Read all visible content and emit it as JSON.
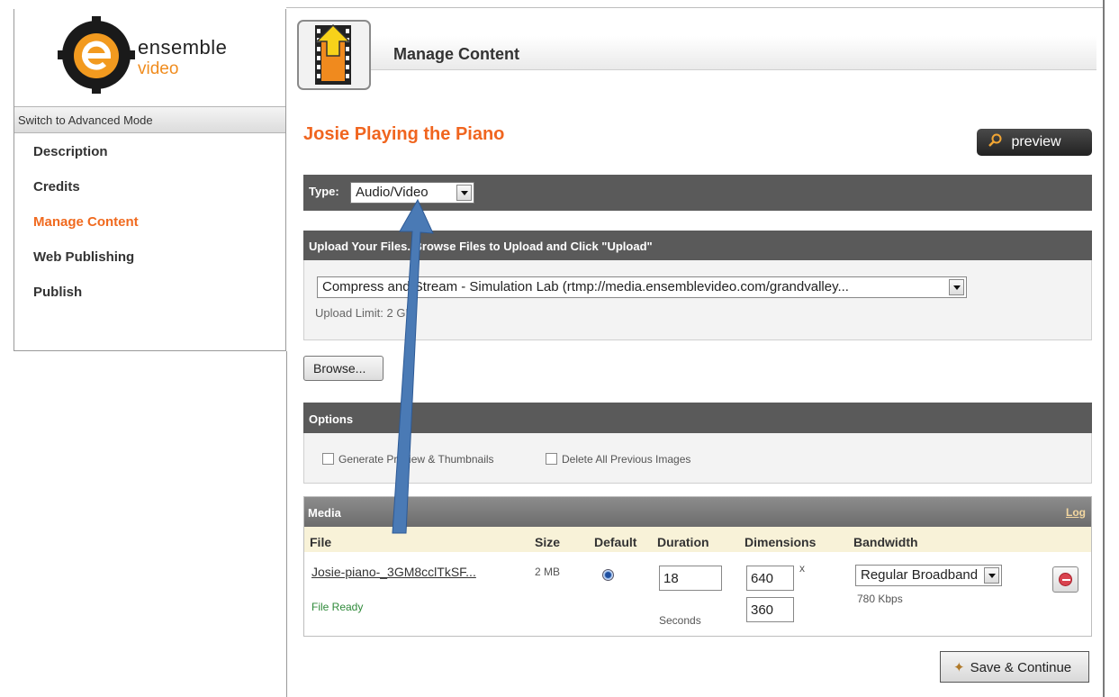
{
  "brand": {
    "name": "ensemble",
    "sub": "video"
  },
  "sidebar": {
    "advanced_mode": "Switch to Advanced Mode",
    "items": [
      {
        "label": "Description"
      },
      {
        "label": "Credits"
      },
      {
        "label": "Manage Content",
        "active": true
      },
      {
        "label": "Web Publishing"
      },
      {
        "label": "Publish"
      }
    ]
  },
  "header": {
    "title": "Manage Content"
  },
  "content": {
    "title": "Josie Playing the Piano",
    "preview_label": "preview"
  },
  "type": {
    "label": "Type:",
    "value": "Audio/Video"
  },
  "upload": {
    "header": "Upload Your Files. Browse Files to Upload and Click \"Upload\"",
    "profile": "Compress and Stream - Simulation Lab (rtmp://media.ensemblevideo.com/grandvalley...",
    "limit": "Upload Limit: 2 GB",
    "browse_label": "Browse..."
  },
  "options": {
    "header": "Options",
    "generate_preview": "Generate Preview & Thumbnails",
    "delete_images": "Delete All Previous Images"
  },
  "media": {
    "header": "Media",
    "log_label": "Log",
    "columns": {
      "file": "File",
      "size": "Size",
      "default": "Default",
      "duration": "Duration",
      "dimensions": "Dimensions",
      "bandwidth": "Bandwidth"
    },
    "row": {
      "file": "Josie-piano-_3GM8cclTkSF...",
      "status": "File Ready",
      "size": "2 MB",
      "duration": "18",
      "duration_unit": "Seconds",
      "width": "640",
      "height": "360",
      "dim_sep": "x",
      "bandwidth": "Regular Broadband",
      "bitrate": "780 Kbps"
    }
  },
  "save_label": "Save & Continue",
  "colors": {
    "accent_orange": "#f0651f",
    "panel_dark": "#5a5a5a",
    "arrow_blue": "#4a7ab5",
    "file_ready_green": "#2f8a3a"
  }
}
